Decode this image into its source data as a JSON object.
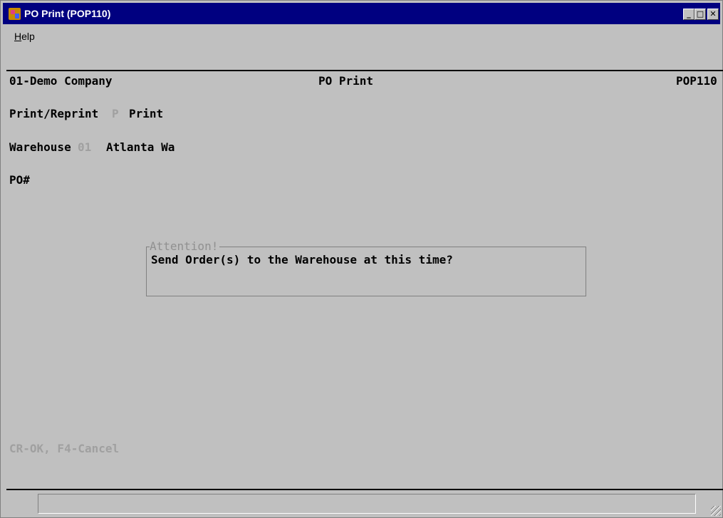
{
  "window": {
    "title": "PO Print (POP110)",
    "controls": {
      "minimize": "_",
      "maximize": "□",
      "close": "✕"
    }
  },
  "menubar": {
    "help_accel": "H",
    "help_rest": "elp"
  },
  "screen": {
    "company": "01-Demo Company",
    "screen_title": "PO Print",
    "program_id": "POP110",
    "print_reprint_label": "Print/Reprint",
    "print_reprint_code": "P",
    "print_reprint_value": "Print",
    "warehouse_label": "Warehouse",
    "warehouse_code": "01",
    "warehouse_name": "Atlanta Wa",
    "po_label": "PO#"
  },
  "dialog": {
    "title": "Attention!",
    "message": "Send Order(s) to the Warehouse at this time?"
  },
  "hint": "CR-OK, F4-Cancel",
  "statusbar": {
    "text": ""
  }
}
